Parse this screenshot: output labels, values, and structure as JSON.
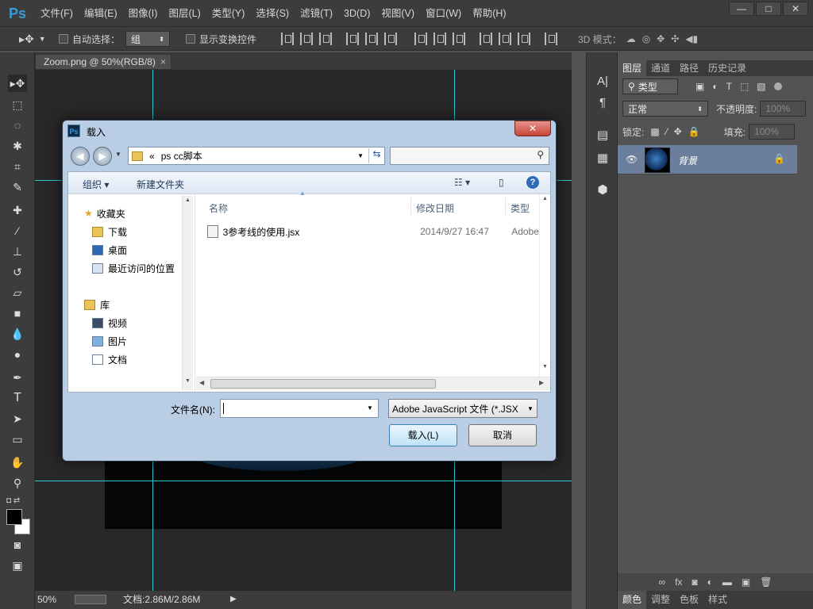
{
  "app": {
    "logo": "Ps"
  },
  "menu": [
    "文件(F)",
    "编辑(E)",
    "图像(I)",
    "图层(L)",
    "类型(Y)",
    "选择(S)",
    "滤镜(T)",
    "3D(D)",
    "视图(V)",
    "窗口(W)",
    "帮助(H)"
  ],
  "window_controls": {
    "minimize": "—",
    "maximize": "□",
    "close": "✕"
  },
  "options": {
    "auto_select_label": "自动选择：",
    "auto_select_value": "组",
    "show_transform_label": "显示变换控件",
    "mode_3d_label": "3D 模式："
  },
  "document_tab": {
    "title": "Zoom.png @ 50%(RGB/8)",
    "close": "×"
  },
  "status": {
    "zoom": "50%",
    "doc_info": "文档:2.86M/2.86M"
  },
  "layers_panel": {
    "tabs": [
      "图层",
      "通道",
      "路径",
      "历史记录"
    ],
    "filter_label": "类型",
    "blend_mode": "正常",
    "opacity_label": "不透明度:",
    "opacity_value": "100%",
    "lock_label": "锁定:",
    "fill_label": "填充:",
    "fill_value": "100%",
    "layer_name": "背景"
  },
  "bottom_tabs": [
    "颜色",
    "调整",
    "色板",
    "样式"
  ],
  "dialog": {
    "title": "载入",
    "path_prefix": "«",
    "path": "ps cc脚本",
    "organize": "组织",
    "new_folder": "新建文件夹",
    "nav": {
      "favorites": "收藏夹",
      "favorites_items": [
        "下载",
        "桌面",
        "最近访问的位置"
      ],
      "libraries": "库",
      "libraries_items": [
        "视频",
        "图片",
        "文档"
      ]
    },
    "columns": {
      "name": "名称",
      "date": "修改日期",
      "type": "类型"
    },
    "files": [
      {
        "name": "3参考线的使用.jsx",
        "date": "2014/9/27 16:47",
        "type": "Adobe"
      }
    ],
    "filename_label": "文件名(N):",
    "filename_value": "",
    "filetype": "Adobe JavaScript 文件 (*.JSX",
    "load_button": "载入(L)",
    "cancel_button": "取消"
  }
}
